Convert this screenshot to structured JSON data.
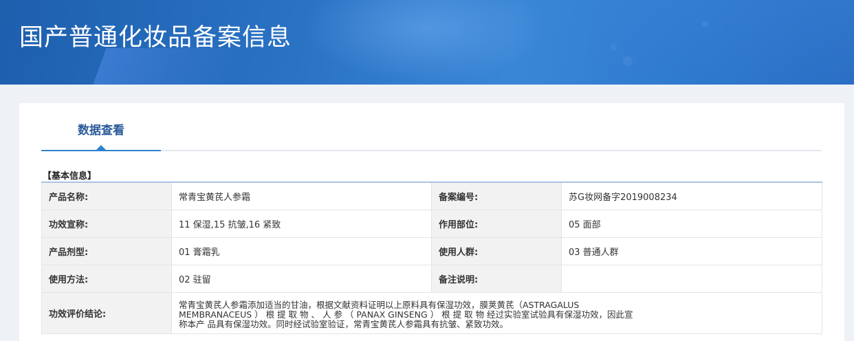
{
  "header": {
    "title": "国产普通化妆品备案信息"
  },
  "tabs": [
    {
      "label": "数据查看"
    }
  ],
  "section": {
    "title": "【基本信息】"
  },
  "table": {
    "rows": [
      {
        "label1": "产品名称:",
        "value1": "常青宝黄芪人参霜",
        "label2": "备案编号:",
        "value2": "苏G妆网备字2019008234"
      },
      {
        "label1": "功效宣称:",
        "value1": "11 保湿,15 抗皱,16 紧致",
        "label2": "作用部位:",
        "value2": "05 面部"
      },
      {
        "label1": "产品剂型:",
        "value1": "01 膏霜乳",
        "label2": "使用人群:",
        "value2": "03 普通人群"
      },
      {
        "label1": "使用方法:",
        "value1": "02 驻留",
        "label2": "备注说明:",
        "value2": ""
      }
    ],
    "conclusion": {
      "label": "功效评价结论:",
      "line1": "常青宝黄芪人参霜添加适当的甘油，根据文献资料证明以上原料具有保湿功效，膜荚黄芪（ASTRAGALUS",
      "line2": "MEMBRANACEUS ） 根 提 取 物 、 人 参 （ PANAX GINSENG ） 根 提 取 物 经过实验室试验具有保湿功效，因此宣",
      "line3": "称本产 品具有保湿功效。同时经试验室验证，常青宝黄芪人参霜具有抗皱、紧致功效。"
    }
  }
}
